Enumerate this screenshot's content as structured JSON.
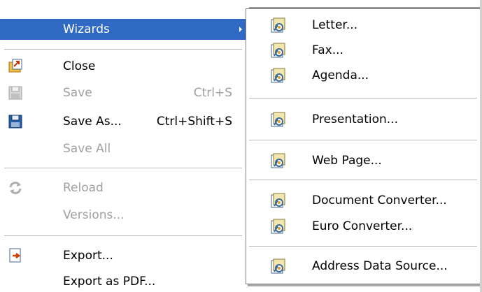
{
  "file_menu": {
    "wizards": "Wizards",
    "close": "Close",
    "save": "Save",
    "save_shortcut": "Ctrl+S",
    "save_as": "Save As...",
    "save_as_shortcut": "Ctrl+Shift+S",
    "save_all": "Save All",
    "reload": "Reload",
    "versions": "Versions...",
    "export": "Export...",
    "export_pdf": "Export as PDF..."
  },
  "wizards_submenu": {
    "letter": "Letter...",
    "fax": "Fax...",
    "agenda": "Agenda...",
    "presentation": "Presentation...",
    "web_page": "Web Page...",
    "document_converter": "Document Converter...",
    "euro_converter": "Euro Converter...",
    "address_data_source": "Address Data Source..."
  },
  "colors": {
    "highlight": "#316ac5",
    "disabled_text": "#a0a0a0"
  },
  "icons": {
    "close": "close-document-icon",
    "save": "floppy-disk-icon",
    "save_as": "floppy-disk-icon",
    "reload": "reload-icon",
    "export": "export-icon",
    "wizard": "wizard-icon"
  }
}
